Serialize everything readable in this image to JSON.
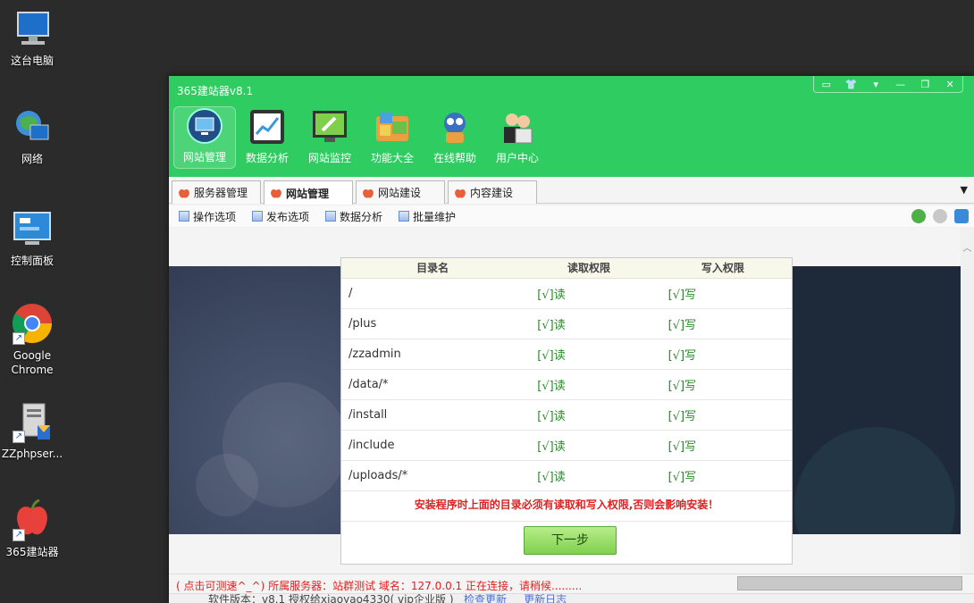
{
  "desktop": {
    "icons": [
      {
        "label": "这台电脑"
      },
      {
        "label": "网络"
      },
      {
        "label": "控制面板"
      },
      {
        "label": "Google Chrome"
      },
      {
        "label": "ZZphpser..."
      },
      {
        "label": "365建站器"
      }
    ]
  },
  "window": {
    "title": "365建站器v8.1",
    "controls": [
      "▭",
      "👕",
      "▾",
      "—",
      "❐",
      "✕"
    ],
    "toolbar": [
      {
        "label": "网站管理",
        "icon": "monitor-icon"
      },
      {
        "label": "数据分析",
        "icon": "chart-icon"
      },
      {
        "label": "网站监控",
        "icon": "wrench-icon"
      },
      {
        "label": "功能大全",
        "icon": "toolbox-icon"
      },
      {
        "label": "在线帮助",
        "icon": "robot-icon"
      },
      {
        "label": "用户中心",
        "icon": "users-icon"
      }
    ],
    "tabs": [
      {
        "label": "服务器管理"
      },
      {
        "label": "网站管理"
      },
      {
        "label": "网站建设"
      },
      {
        "label": "内容建设"
      }
    ],
    "subbar": [
      {
        "label": "操作选项"
      },
      {
        "label": "发布选项"
      },
      {
        "label": "数据分析"
      },
      {
        "label": "批量维护"
      }
    ]
  },
  "permissions": {
    "headers": [
      "目录名",
      "读取权限",
      "写入权限"
    ],
    "rows": [
      {
        "dir": "/",
        "read": "[√]读",
        "write": "[√]写"
      },
      {
        "dir": "/plus",
        "read": "[√]读",
        "write": "[√]写"
      },
      {
        "dir": "/zzadmin",
        "read": "[√]读",
        "write": "[√]写"
      },
      {
        "dir": "/data/*",
        "read": "[√]读",
        "write": "[√]写"
      },
      {
        "dir": "/install",
        "read": "[√]读",
        "write": "[√]写"
      },
      {
        "dir": "/include",
        "read": "[√]读",
        "write": "[√]写"
      },
      {
        "dir": "/uploads/*",
        "read": "[√]读",
        "write": "[√]写"
      }
    ],
    "warning": "安装程序时上面的目录必须有读取和写入权限,否则会影响安装！",
    "next_button": "下一步"
  },
  "status": {
    "line1": "( 点击可测速^_^) 所属服务器：站群测试 域名：127.0.0.1  正在连接，请稍候.........",
    "line2_version": "软件版本：v8.1  授权给xiaoyao4330( vip企业版 )",
    "line2_check": "检查更新",
    "line2_log": "更新日志"
  },
  "colors": {
    "header_green": "#2ecc61",
    "warning_red": "#e02020",
    "ok_green": "#2a8a2a"
  }
}
